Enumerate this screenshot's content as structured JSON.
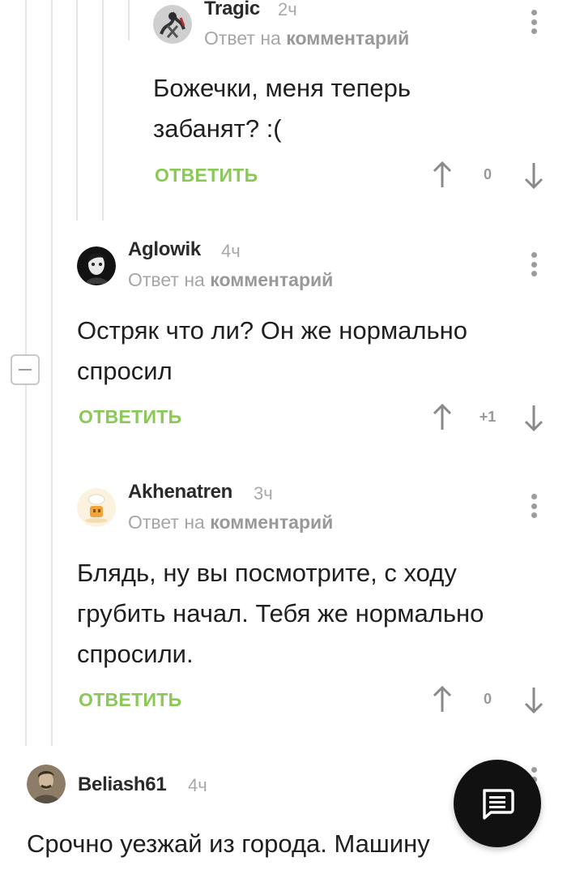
{
  "reply_to_prefix": "Ответ на",
  "reply_to_target": "комментарий",
  "reply_label": "ОТВЕТИТЬ",
  "comments": [
    {
      "author": "Tragic",
      "time": "2ч",
      "text_lines": [
        "Божечки, меня теперь",
        "забанят? :("
      ],
      "score": "0",
      "avatar_icon": "abstract-figure-avatar"
    },
    {
      "author": "Aglowik",
      "time": "4ч",
      "text_lines": [
        "Остряк что ли? Он же нормально",
        "спросил"
      ],
      "score": "+1",
      "avatar_icon": "dark-portrait-avatar"
    },
    {
      "author": "Akhenatren",
      "time": "3ч",
      "text_lines": [
        "Блядь, ну вы посмотрите, с ходу",
        "грубить начал. Тебя же нормально",
        "спросили."
      ],
      "score": "0",
      "avatar_icon": "chef-cartoon-avatar"
    },
    {
      "author": "Beliash61",
      "time": "4ч",
      "text_lines": [
        "Срочно уезжай из города. Машину"
      ],
      "avatar_icon": "portrait-photo-avatar"
    }
  ],
  "fab_icon": "comment-bubble-icon",
  "colors": {
    "reply_green": "#8ac858",
    "fab_background": "#111111",
    "thread_line": "#e6e6e6"
  }
}
